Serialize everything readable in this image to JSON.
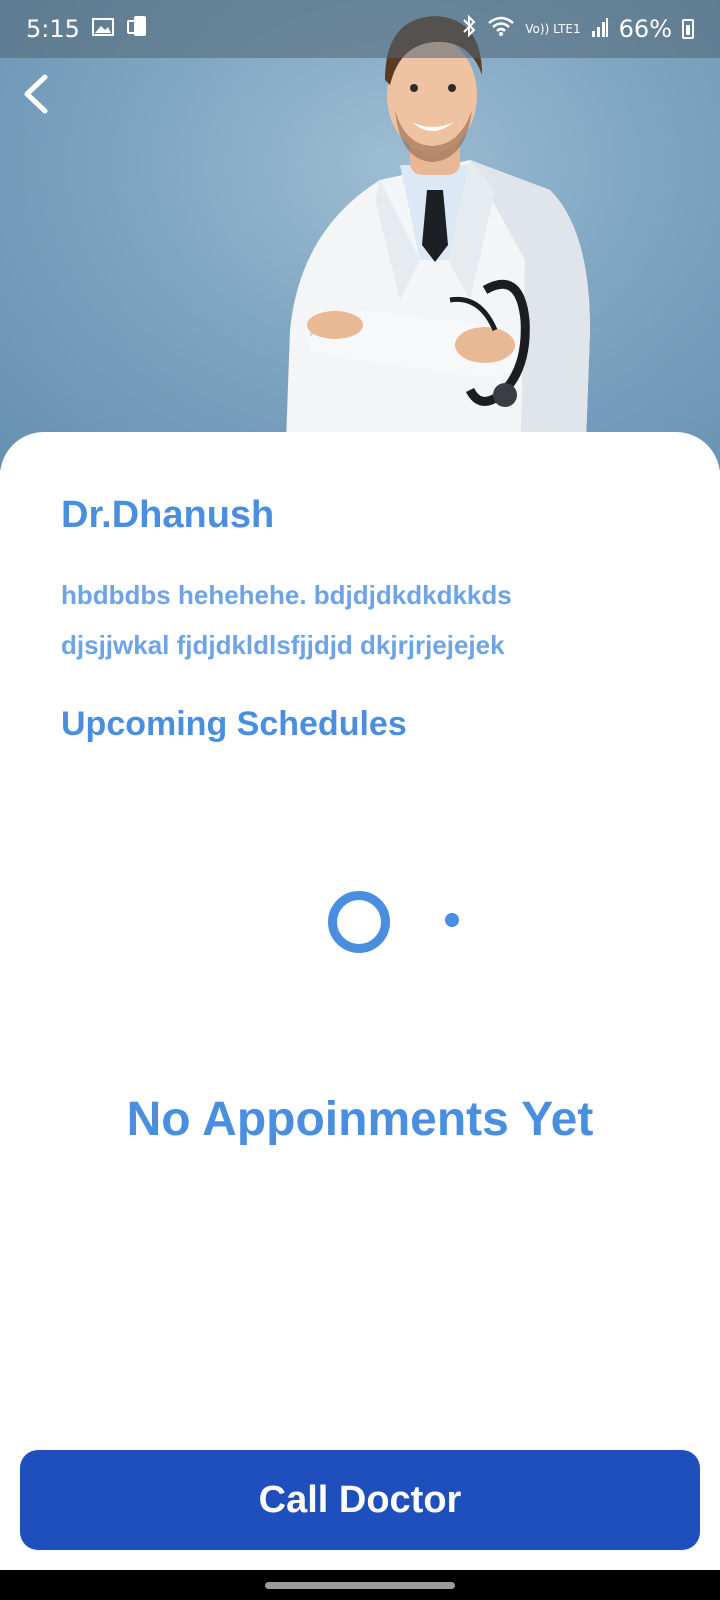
{
  "status_bar": {
    "time": "5:15",
    "network_label": "Vo)) LTE1",
    "battery_percent": "66%",
    "icons": [
      "image-icon",
      "phone-sync-icon",
      "bluetooth-icon",
      "wifi-icon",
      "signal-icon",
      "battery-icon"
    ]
  },
  "header": {
    "back_icon": "chevron-left-icon",
    "hero_image": "doctor-photo"
  },
  "doctor": {
    "name": "Dr.Dhanush",
    "description_line1": "hbdbdbs hehehehe. bdjdjdkdkdkkds",
    "description_line2": "djsjjwkal fjdjdkldlsfjjdjd dkjrjrjejejek"
  },
  "schedules": {
    "title": "Upcoming Schedules",
    "empty_message": "No Appoinments Yet"
  },
  "actions": {
    "call_label": "Call Doctor"
  },
  "colors": {
    "primary_text": "#4a8ee0",
    "secondary_text": "#6ea3e6",
    "button": "#1f4fbd",
    "hero_bg": "#7fa6c2"
  }
}
